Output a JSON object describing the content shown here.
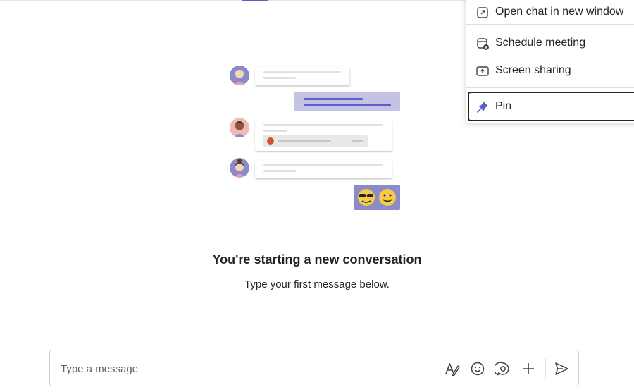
{
  "context_menu": {
    "items": [
      {
        "label": "Open chat in new window",
        "icon": "open-in-new-window-icon"
      },
      {
        "label": "Schedule meeting",
        "icon": "calendar-add-icon"
      },
      {
        "label": "Screen sharing",
        "icon": "screen-share-icon"
      },
      {
        "label": "Pin",
        "icon": "pin-icon"
      }
    ]
  },
  "empty_state": {
    "title": "You're starting a new conversation",
    "subtitle": "Type your first message below."
  },
  "compose": {
    "placeholder": "Type a message",
    "tools": [
      "format-icon",
      "emoji-icon",
      "sticker-icon",
      "add-icon",
      "send-icon"
    ]
  },
  "colors": {
    "accent": "#5b5fc7",
    "bubble_self": "#c5c3e3",
    "emoji_bubble": "#8b8cc7"
  }
}
